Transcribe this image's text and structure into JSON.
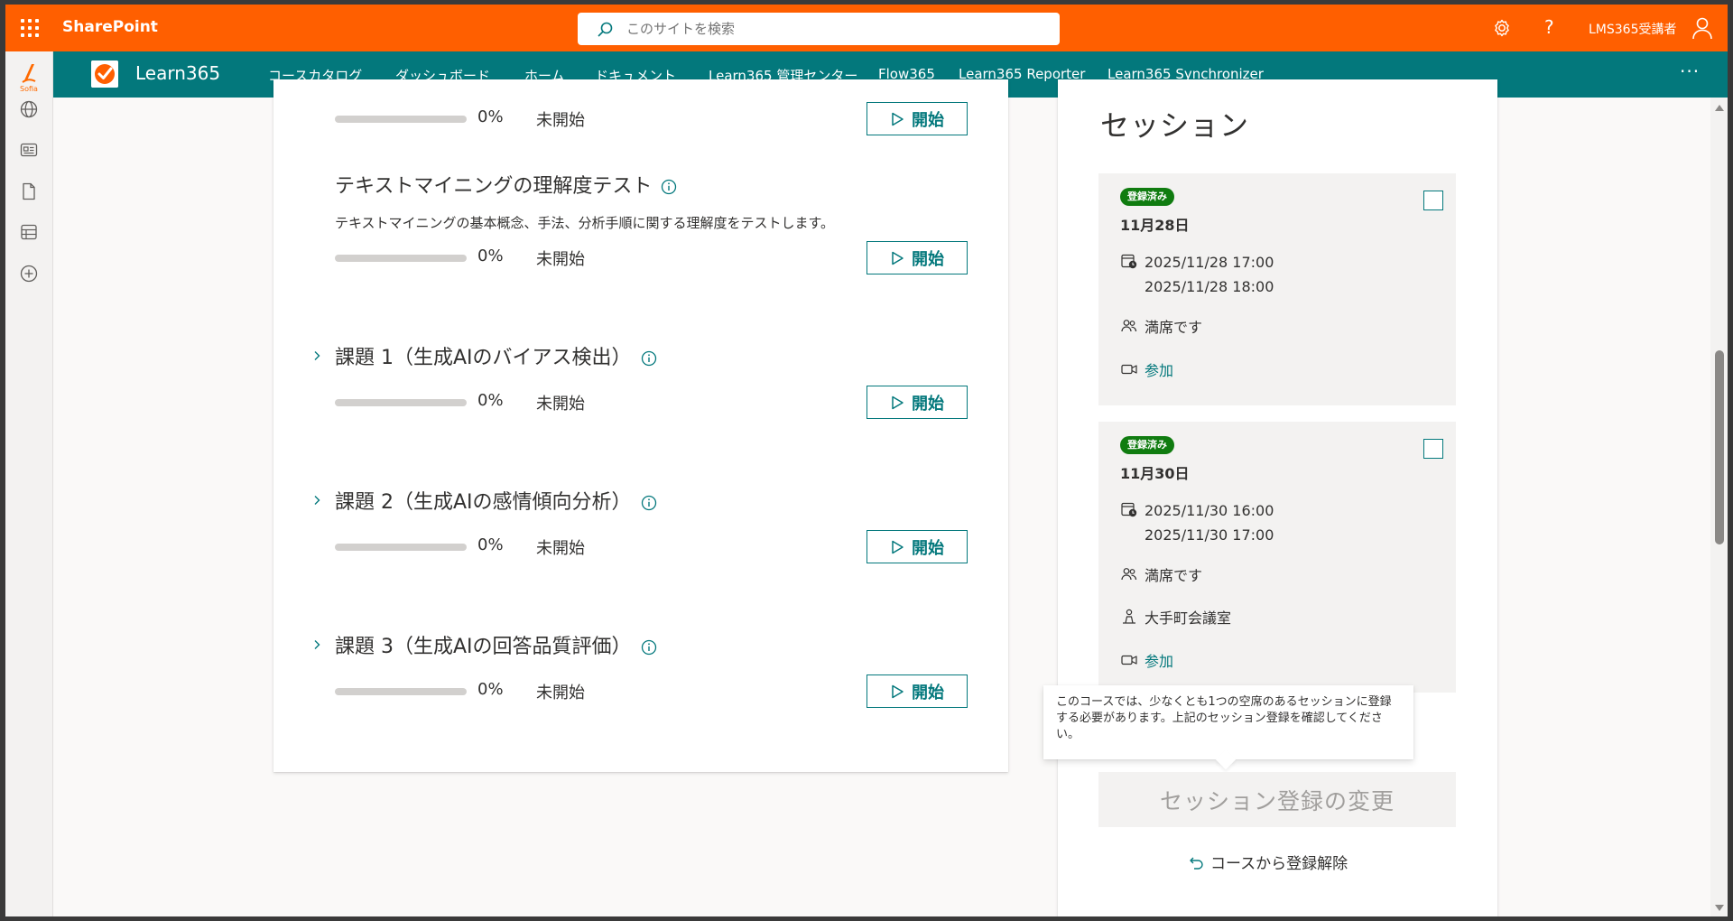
{
  "suitebar": {
    "app_name": "SharePoint",
    "search_placeholder": "このサイトを検索",
    "help_glyph": "?",
    "user_name": "LMS365受講者",
    "color": "#ff5f00"
  },
  "rail": {
    "logo_text": "Sofia",
    "icons": [
      "globe-icon",
      "news-icon",
      "document-icon",
      "list-icon",
      "add-icon"
    ]
  },
  "nav": {
    "site_name": "Learn365",
    "links": [
      "コースカタログ",
      "ダッシュボード",
      "ホーム",
      "ドキュメント",
      "Learn365 管理センター",
      "Flow365",
      "Learn365 Reporter",
      "Learn365 Synchronizer"
    ],
    "more_glyph": "···",
    "color": "#03787c"
  },
  "activities": [
    {
      "title": "",
      "description": "",
      "progress_percent": 0,
      "progress_label": "0%",
      "status": "未開始",
      "button_label": "開始",
      "expandable": false
    },
    {
      "title": "テキストマイニングの理解度テスト",
      "description": "テキストマイニングの基本概念、手法、分析手順に関する理解度をテストします。",
      "progress_percent": 0,
      "progress_label": "0%",
      "status": "未開始",
      "button_label": "開始",
      "expandable": false
    },
    {
      "title": "課題 1（生成AIのバイアス検出）",
      "description": "",
      "progress_percent": 0,
      "progress_label": "0%",
      "status": "未開始",
      "button_label": "開始",
      "expandable": true
    },
    {
      "title": "課題 2（生成AIの感情傾向分析）",
      "description": "",
      "progress_percent": 0,
      "progress_label": "0%",
      "status": "未開始",
      "button_label": "開始",
      "expandable": true
    },
    {
      "title": "課題 3（生成AIの回答品質評価）",
      "description": "",
      "progress_percent": 0,
      "progress_label": "0%",
      "status": "未開始",
      "button_label": "開始",
      "expandable": true
    }
  ],
  "sessions_panel": {
    "heading": "セッション",
    "sessions": [
      {
        "badge": "登録済み",
        "date": "11月28日",
        "start": "2025/11/28 17:00",
        "end": "2025/11/28 18:00",
        "capacity": "満席です",
        "location": "",
        "join_label": "参加",
        "checked": false
      },
      {
        "badge": "登録済み",
        "date": "11月30日",
        "start": "2025/11/30 16:00",
        "end": "2025/11/30 17:00",
        "capacity": "満席です",
        "location": "大手町会議室",
        "join_label": "参加",
        "checked": false
      }
    ],
    "tooltip": "このコースでは、少なくとも1つの空席のあるセッションに登録する必要があります。上記のセッション登録を確認してください。",
    "change_button": "セッション登録の変更",
    "unregister_link": "コースから登録解除"
  }
}
